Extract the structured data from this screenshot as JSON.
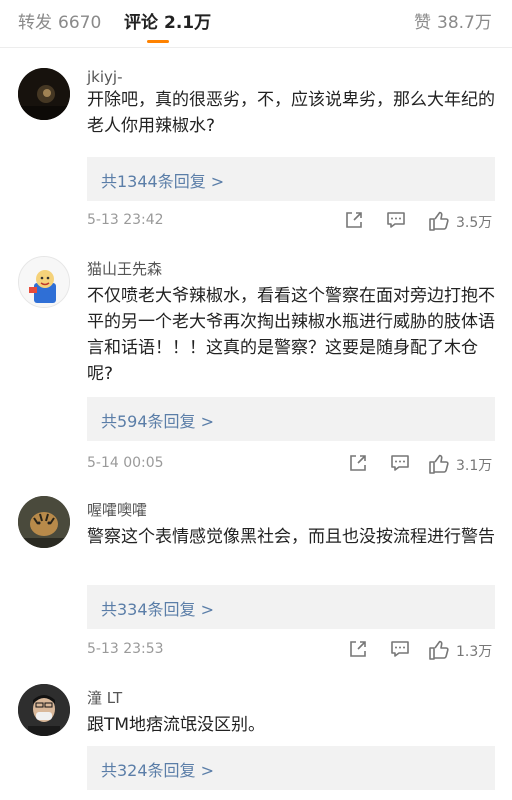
{
  "tabs": [
    {
      "label": "转发",
      "count": "6670"
    },
    {
      "label": "评论",
      "count": "2.1万"
    },
    {
      "label": "赞",
      "count": "38.7万"
    }
  ],
  "comments": [
    {
      "username": "jkiyj-",
      "avatar": "dark-photo-avatar",
      "text": "开除吧，真的很恶劣，不，应该说卑劣，那么大年纪的老人你用辣椒水?",
      "replies": "共1344条回复 >",
      "time": "5-13 23:42",
      "likes": "3.5万"
    },
    {
      "username": "猫山王先森",
      "avatar": "cartoon-avatar",
      "avatar_text": "打你哦",
      "text": "不仅喷老大爷辣椒水，看看这个警察在面对旁边打抱不平的另一个老大爷再次掏出辣椒水瓶进行威胁的肢体语言和话语！！！这真的是警察？这要是随身配了木仓呢?",
      "replies": "共594条回复 >",
      "time": "5-14 00:05",
      "likes": "3.1万"
    },
    {
      "username": "喔嚯噢嚯",
      "avatar": "tiger-photo-avatar",
      "text": "警察这个表情感觉像黑社会，而且也没按流程进行警告",
      "replies": "共334条回复 >",
      "time": "5-13 23:53",
      "likes": "1.3万"
    },
    {
      "username": "潼 LT",
      "avatar": "masked-person-avatar",
      "text": "跟TM地痞流氓没区别。",
      "replies": "共324条回复 >"
    }
  ],
  "icons": {
    "share": "share-icon",
    "comment": "comment-icon",
    "like": "like-icon"
  },
  "colors": {
    "accent": "#ff8200",
    "link": "#5b7ea8",
    "reply_bg": "#f2f2f2"
  }
}
